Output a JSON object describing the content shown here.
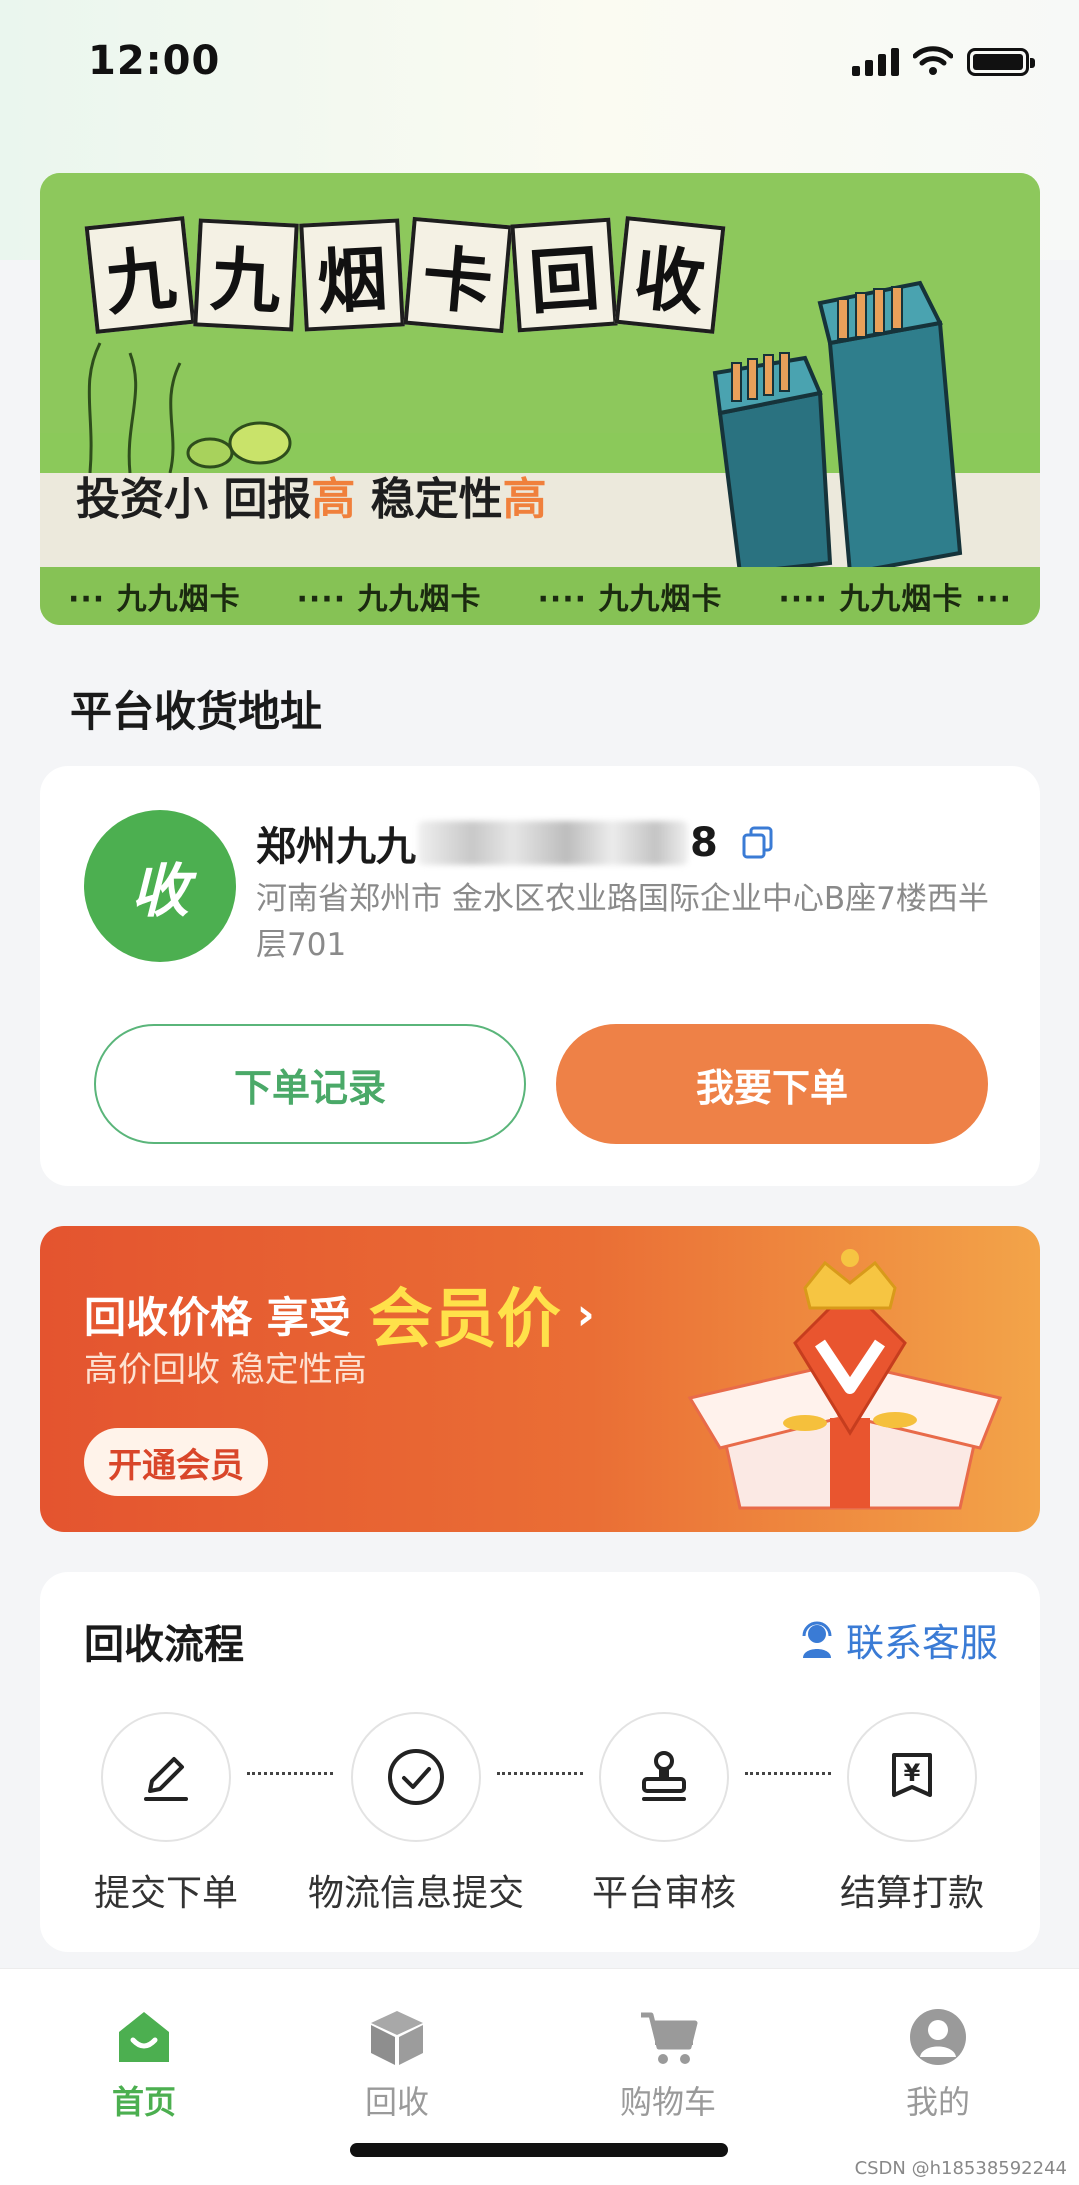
{
  "status": {
    "time": "12:00"
  },
  "banner": {
    "title_chars": [
      "九",
      "九",
      "烟",
      "卡",
      "回",
      "收"
    ],
    "slogan_parts": [
      "投资小 回报",
      "高",
      " 稳定性",
      "高"
    ],
    "strip_items": [
      "··· 九九烟卡",
      "···· 九九烟卡",
      "···· 九九烟卡",
      "···· 九九烟卡 ···"
    ]
  },
  "address_section": {
    "title": "平台收货地址",
    "avatar_label": "收",
    "name_prefix": "郑州九九",
    "name_suffix": "8",
    "address": "河南省郑州市 金水区农业路国际企业中心B座7楼西半层701",
    "order_history_label": "下单记录",
    "place_order_label": "我要下单"
  },
  "member": {
    "line1": "回收价格 享受",
    "highlight": "会员价",
    "chevron": "›",
    "subtitle": "高价回收 稳定性高",
    "cta": "开通会员"
  },
  "process": {
    "title": "回收流程",
    "contact_label": "联系客服",
    "steps": [
      {
        "label": "提交下单",
        "icon": "edit-icon"
      },
      {
        "label": "物流信息提交",
        "icon": "check-circle-icon"
      },
      {
        "label": "平台审核",
        "icon": "stamp-icon"
      },
      {
        "label": "结算打款",
        "icon": "yuan-bill-icon"
      }
    ]
  },
  "tabbar": {
    "tabs": [
      {
        "label": "首页",
        "icon": "home-icon",
        "active": true
      },
      {
        "label": "回收",
        "icon": "box-icon",
        "active": false
      },
      {
        "label": "购物车",
        "icon": "cart-icon",
        "active": false
      },
      {
        "label": "我的",
        "icon": "profile-icon",
        "active": false
      }
    ]
  },
  "watermark": "CSDN @h18538592244",
  "colors": {
    "brand_green": "#4caf50",
    "accent_orange": "#ee8147",
    "member_gold": "#ffe14a",
    "link_blue": "#3a7bd5"
  }
}
